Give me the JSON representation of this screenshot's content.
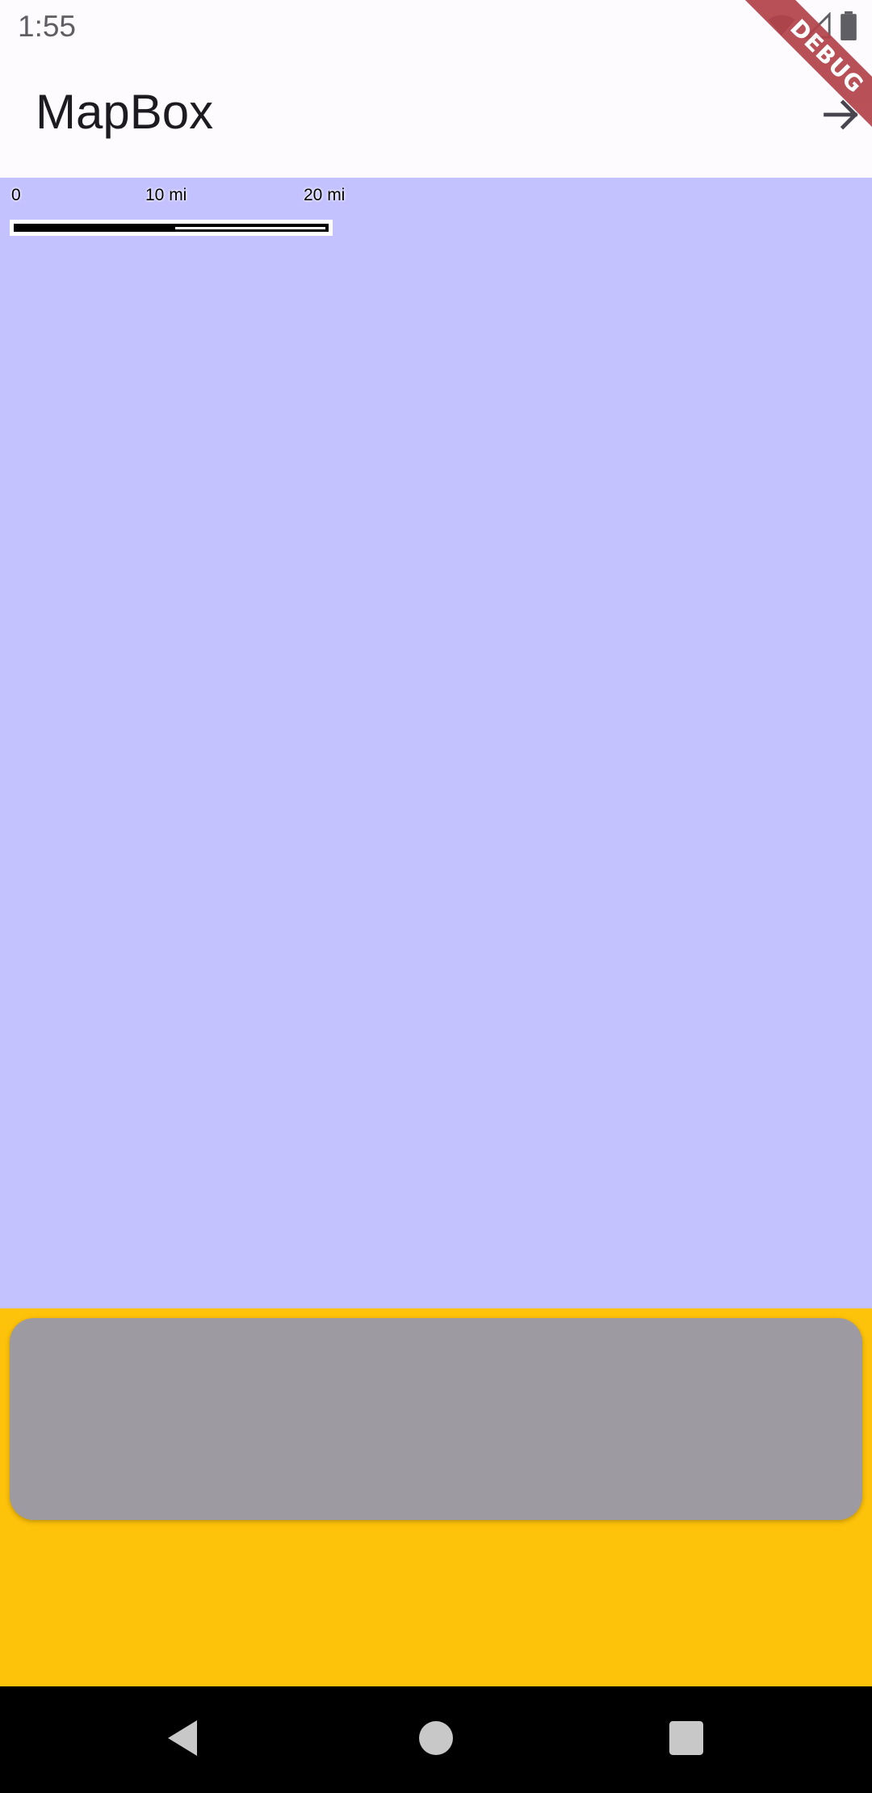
{
  "status_bar": {
    "time": "1:55",
    "icons": [
      "wifi-icon",
      "cell-signal-icon",
      "battery-icon"
    ]
  },
  "debug_banner": {
    "label": "DEBUG",
    "color": "#b3424a"
  },
  "app_bar": {
    "title": "MapBox",
    "action_icon": "arrow-forward-icon"
  },
  "map": {
    "background_color": "#c4c2fe",
    "scale_bar": {
      "labels": [
        "0",
        "10 mi",
        "20 mi"
      ]
    }
  },
  "bottom_panel": {
    "background_color": "#fdc20a",
    "card_color": "#9e9aa1"
  },
  "nav_bar": {
    "buttons": [
      "back-icon",
      "home-icon",
      "recents-icon"
    ]
  }
}
